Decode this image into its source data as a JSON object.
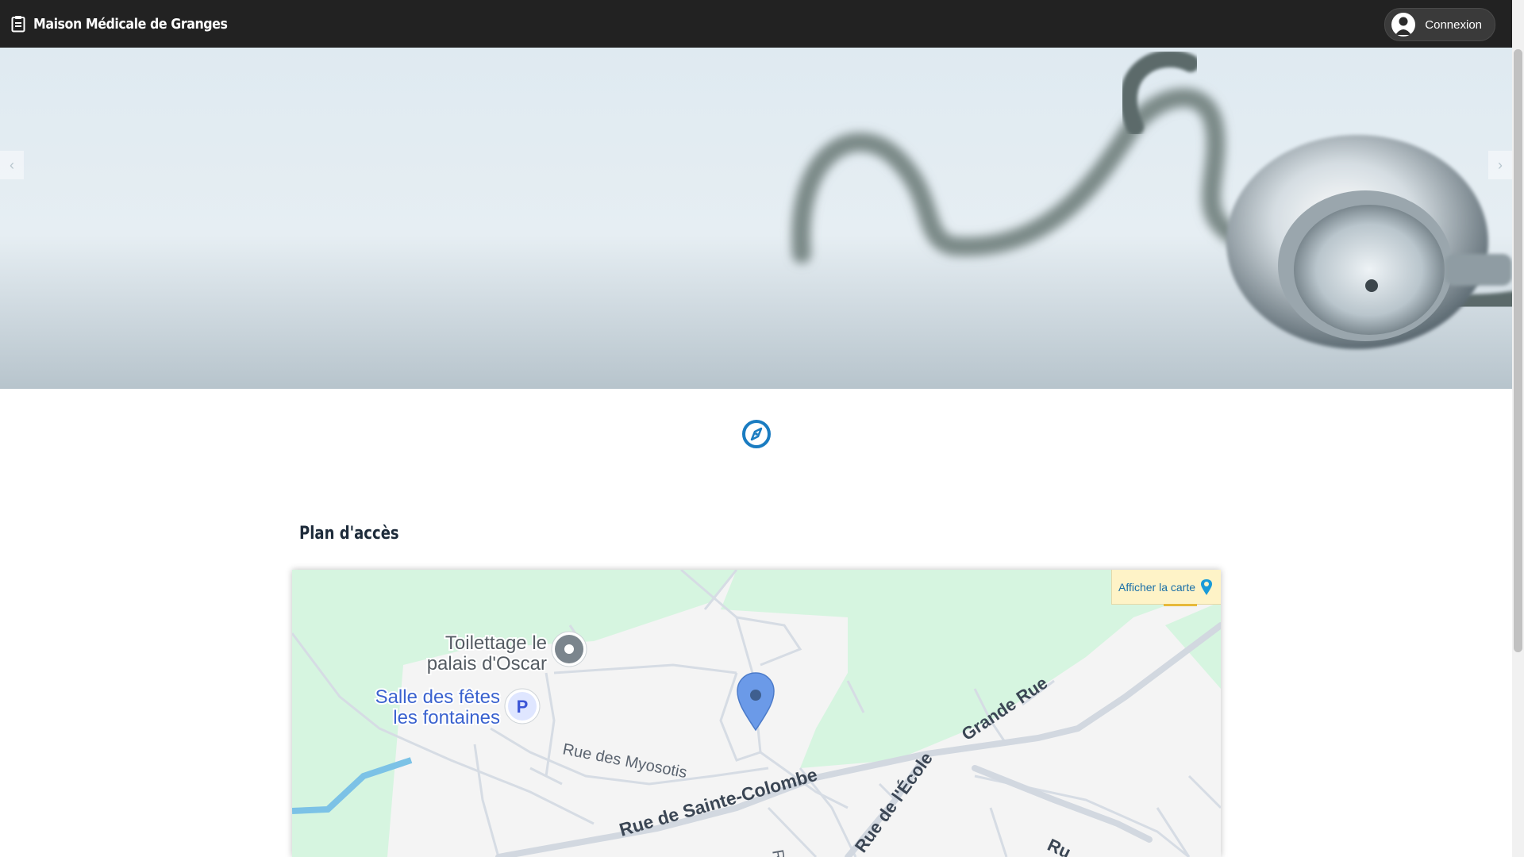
{
  "header": {
    "brand_title": "Maison Médicale de Granges",
    "login_label": "Connexion"
  },
  "hero": {
    "prev_label": "‹",
    "next_label": "›"
  },
  "access": {
    "title": "Plan d'accès",
    "show_map_label": "Afficher la carte"
  },
  "map": {
    "places": {
      "groomer_line1": "Toilettage le",
      "groomer_line2": "palais d'Oscar",
      "hall_line1": "Salle des fêtes",
      "hall_line2": "les fontaines",
      "parking_letter": "P"
    },
    "streets": {
      "myosotis": "Rue des Myosotis",
      "sainte_colombe": "Rue de Sainte-Colombe",
      "grande_rue": "Grande Rue",
      "ecole": "Rue de l'École",
      "partial_r1": "R",
      "partial_r2": "Ru"
    }
  },
  "colors": {
    "navbar": "#222222",
    "accent_blue": "#1a7cc1",
    "map_green": "#d6f5e0",
    "map_road": "#d6dce4",
    "map_button_bg": "#fef3c7"
  },
  "icons": {
    "brand": "clipboard-icon",
    "login": "user-icon",
    "compass": "compass-icon",
    "map_button": "map-pin-icon"
  }
}
